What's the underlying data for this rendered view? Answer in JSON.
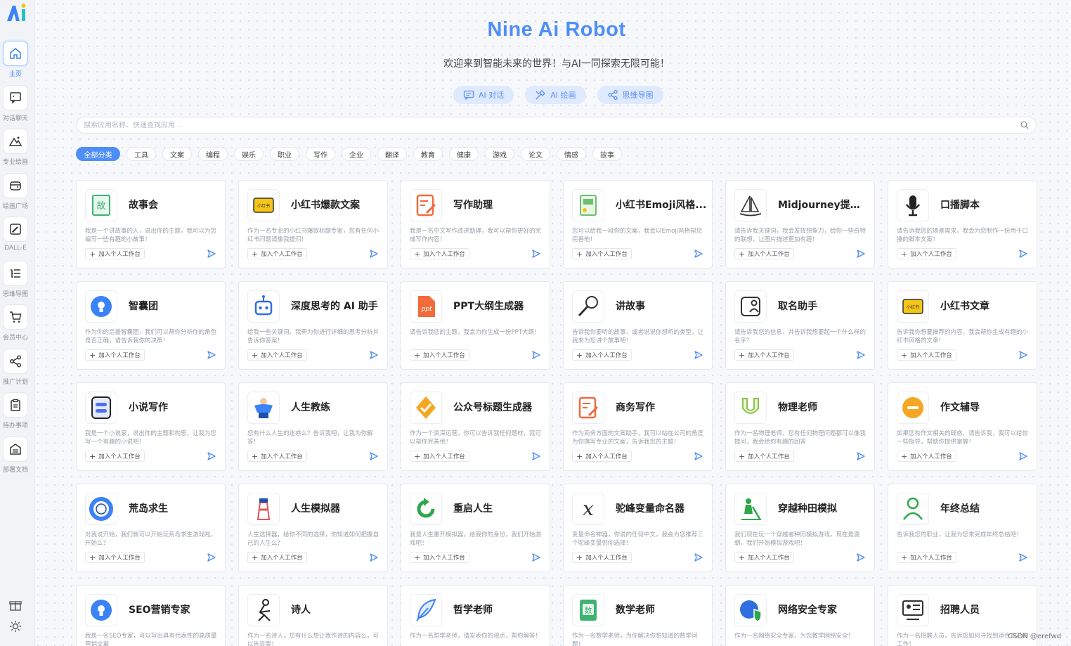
{
  "app": {
    "title": "Nine Ai Robot",
    "subtitle": "欢迎来到智能未来的世界！与AI一同探索无限可能！"
  },
  "sidebar": {
    "items": [
      {
        "label": "主页",
        "icon": "home-icon",
        "active": true
      },
      {
        "label": "对话聊天",
        "icon": "chat-icon"
      },
      {
        "label": "专业绘画",
        "icon": "mountain-icon"
      },
      {
        "label": "绘画广场",
        "icon": "wallet-icon"
      },
      {
        "label": "DALL-E",
        "icon": "paint-icon"
      },
      {
        "label": "思维导图",
        "icon": "mindmap-icon"
      },
      {
        "label": "会员中心",
        "icon": "cart-icon"
      },
      {
        "label": "推广计划",
        "icon": "share-icon"
      },
      {
        "label": "待办事项",
        "icon": "clipboard-icon"
      },
      {
        "label": "部署文档",
        "icon": "archive-icon"
      }
    ]
  },
  "quick_tabs": [
    {
      "label": "AI 对话",
      "icon": "chat-icon"
    },
    {
      "label": "AI 绘画",
      "icon": "brush-icon"
    },
    {
      "label": "思维导图",
      "icon": "share-icon"
    }
  ],
  "search": {
    "placeholder": "搜索应用名称、快速查找应用..."
  },
  "categories": [
    "全部分类",
    "工具",
    "文案",
    "编程",
    "娱乐",
    "职业",
    "写作",
    "企业",
    "翻译",
    "教育",
    "健康",
    "游戏",
    "论文",
    "情感",
    "故事"
  ],
  "add_label": "加入个人工作台",
  "cards": [
    {
      "title": "故事会",
      "desc": "我是一个讲故事的人，说出你的主题，我可以为您编写一些有趣的小故事！",
      "icon": "book-icon",
      "color": "#3cb371"
    },
    {
      "title": "小红书爆款文案",
      "desc": "作为一名专业的小红书爆款标题专家，您有任何小红书问题请像我提问！",
      "icon": "xiaohongshu-icon",
      "color": "#f5c518"
    },
    {
      "title": "写作助理",
      "desc": "我是一名中文写作改进助理，我可以帮你更好的完成写作内容！",
      "icon": "edit-doc-icon",
      "color": "#f06a3e"
    },
    {
      "title": "小红书Emoji风格...",
      "desc": "您可以给我一段你的文案，我会以Emoji风格帮您完善他！",
      "icon": "emoji-doc-icon",
      "color": "#6cc070"
    },
    {
      "title": "Midjourney提示...",
      "desc": "请告诉我关键词，我会发挥想象力，给你一些奇特的联想，让图片描述更加有趣！",
      "icon": "sailboat-icon",
      "color": "#333333"
    },
    {
      "title": "口播脚本",
      "desc": "请告诉我您的场景需求，我会为您制作一份用于口播的脚本文案！",
      "icon": "microphone-icon",
      "color": "#222222"
    },
    {
      "title": "智囊团",
      "desc": "作为你的后援智囊团，我们可以帮你分析你的角色是否正确，请告诉我你的决策！",
      "icon": "lightbulb-icon",
      "color": "#3b82f6"
    },
    {
      "title": "深度思考的 AI 助手",
      "desc": "给我一些关键词，我帮为你进行详细的思考分析并告诉你答案！",
      "icon": "robot-icon",
      "color": "#2f6fe0"
    },
    {
      "title": "PPT大纲生成器",
      "desc": "请告诉我您的主题，我会为你生成一份PPT大纲！",
      "icon": "ppt-icon",
      "color": "#f26b3a"
    },
    {
      "title": "讲故事",
      "desc": "告诉我你要听的故事，或者说说你想听的类型，让我来为您讲个故事吧！",
      "icon": "microphone-ball-icon",
      "color": "#333333"
    },
    {
      "title": "取名助手",
      "desc": "请告诉我您的信息，并告诉我想要起一个什么样的名字？",
      "icon": "contact-icon",
      "color": "#333333"
    },
    {
      "title": "小红书文章",
      "desc": "告诉我你想要推荐的内容，我会帮你生成有趣的小红书风格的文章！",
      "icon": "xiaohongshu-icon",
      "color": "#f5c518"
    },
    {
      "title": "小说写作",
      "desc": "我是一个小说家，说出你的主题和构思，让我为您写一个有趣的小说吧！",
      "icon": "novel-icon",
      "color": "#4f6ef7"
    },
    {
      "title": "人生教练",
      "desc": "您有什么人生的迷惑么？告诉我吧，让我为你解答！",
      "icon": "strongman-icon",
      "color": "#3b82f6"
    },
    {
      "title": "公众号标题生成器",
      "desc": "作为一个资深运营，你可以告诉我任何题材，我可以帮你完善他！",
      "icon": "check-badge-icon",
      "color": "#f5a623"
    },
    {
      "title": "商务写作",
      "desc": "作为商务方面的文案助手，我可以站在公司的角度为你撰写专业的文案，告诉我您的主题！",
      "icon": "edit-doc-icon",
      "color": "#f06a3e"
    },
    {
      "title": "物理老师",
      "desc": "作为一名物理老师，您有任何物理问题都可以像我提问，我会给你有趣的回答",
      "icon": "magnet-icon",
      "color": "#8bc34a"
    },
    {
      "title": "作文辅导",
      "desc": "如果您有作文相关的疑惑，请告诉我，我可以给你一些指导，帮助你提供掌握！",
      "icon": "minus-circle-icon",
      "color": "#f5a623"
    },
    {
      "title": "荒岛求生",
      "desc": "对我说开始，我们就可以开始玩荒岛求生游戏啦，开始么？",
      "icon": "lifebuoy-icon",
      "color": "#3b82f6"
    },
    {
      "title": "人生模拟器",
      "desc": "人生选择器，给你不同的选择，你知道如何把握自己的人生么？",
      "icon": "lighthouse-icon",
      "color": "#e05555"
    },
    {
      "title": "重启人生",
      "desc": "我是人生重开模拟器，给我你的身份，我们开始游戏吧！",
      "icon": "restart-icon",
      "color": "#2ea84a"
    },
    {
      "title": "驼峰变量命名器",
      "desc": "变量命名神器，你说的任何中文，我会为您推荐三个驼峰变量供你选择！",
      "icon": "variable-icon",
      "color": "#333333"
    },
    {
      "title": "穿越种田模拟",
      "desc": "我们现在玩一个穿越者种田模拟游戏，现在是唐朝，我们开始模拟游戏吧！",
      "icon": "farmer-icon",
      "color": "#2ea84a"
    },
    {
      "title": "年终总结",
      "desc": "告诉我您的职业，让我为您来完成年终总结吧！",
      "icon": "person-icon",
      "color": "#2ea84a"
    },
    {
      "title": "SEO营销专家",
      "desc": "我是一名SEO专家，可以写出具有代表性的高质量营销文章",
      "icon": "lightbulb-icon",
      "color": "#3b82f6"
    },
    {
      "title": "诗人",
      "desc": "作为一名诗人，您有什么想让我作诗的内容么，可以告诉我！",
      "icon": "poet-icon",
      "color": "#222222"
    },
    {
      "title": "哲学老师",
      "desc": "作为一名哲学老师，请发表你的观点，帮你解答！",
      "icon": "feather-icon",
      "color": "#3b82f6"
    },
    {
      "title": "数学老师",
      "desc": "作为一名数学老师，为你解决你想知道的数学问题！",
      "icon": "math-book-icon",
      "color": "#3cb371"
    },
    {
      "title": "网络安全专家",
      "desc": "作为一名网络安全专家，为您教学网络安全！",
      "icon": "globe-shield-icon",
      "color": "#2f6fe0"
    },
    {
      "title": "招聘人员",
      "desc": "作为一名招聘人员，告诉您如何寻找到适合自己的工作！",
      "icon": "recruiter-icon",
      "color": "#333333"
    }
  ],
  "watermark": "CSDN @erefwd",
  "colors": {
    "accent": "#4f8ef7",
    "tab_bg": "#dfeafe"
  }
}
